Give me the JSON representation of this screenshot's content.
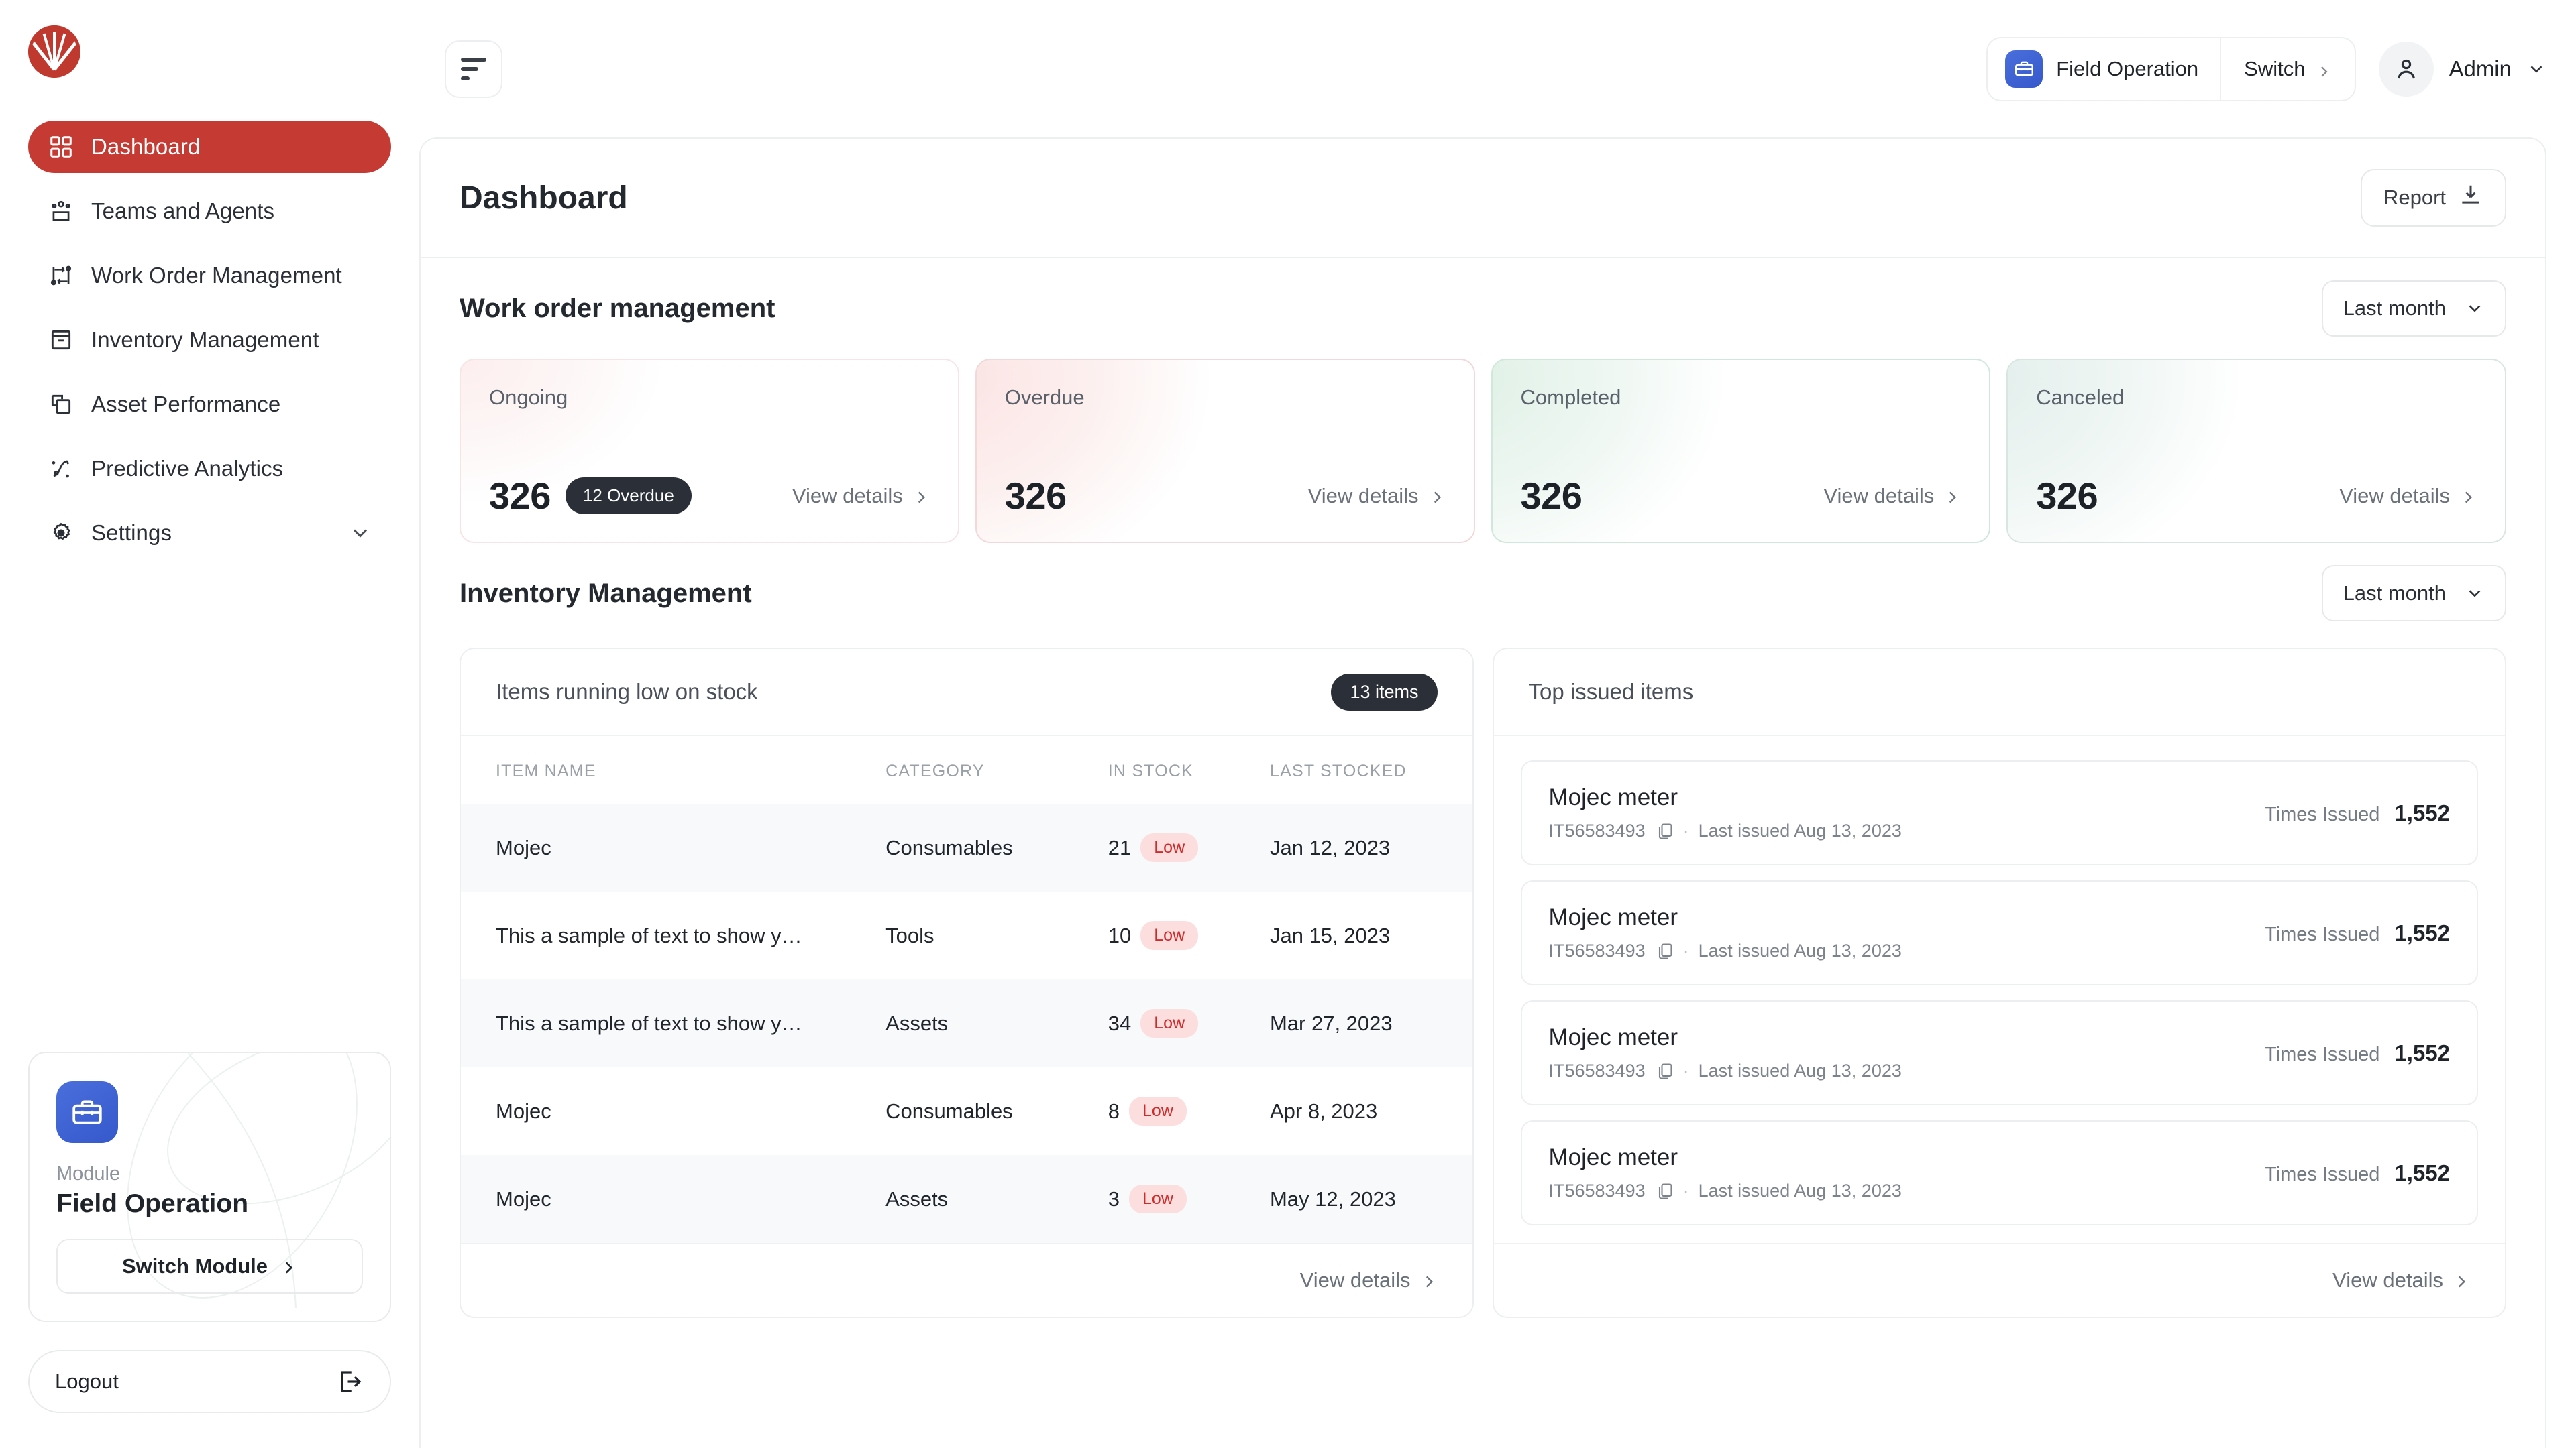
{
  "brand": {
    "logo_name": "company-logo",
    "accent": "#c53a33"
  },
  "sidebar": {
    "items": [
      {
        "label": "Dashboard",
        "icon": "grid-icon",
        "active": true
      },
      {
        "label": "Teams and Agents",
        "icon": "users-icon",
        "active": false
      },
      {
        "label": "Work Order Management",
        "icon": "workflow-icon",
        "active": false
      },
      {
        "label": "Inventory Management",
        "icon": "inventory-box-icon",
        "active": false
      },
      {
        "label": "Asset Performance",
        "icon": "copy-layers-icon",
        "active": false
      },
      {
        "label": "Predictive Analytics",
        "icon": "strategy-icon",
        "active": false
      },
      {
        "label": "Settings",
        "icon": "gear-icon",
        "active": false,
        "expandable": true
      }
    ],
    "module_card": {
      "icon": "toolbox-icon",
      "label": "Module",
      "title": "Field Operation",
      "switch_label": "Switch Module"
    },
    "logout_label": "Logout",
    "logout_icon": "logout-icon"
  },
  "topbar": {
    "collapse_icon": "collapse-sidebar-icon",
    "module_pill": {
      "icon": "toolbox-icon",
      "name": "Field Operation",
      "switch_label": "Switch"
    },
    "user": {
      "name": "Admin",
      "avatar_icon": "user-avatar-icon",
      "chevron": "chevron-down-icon"
    }
  },
  "page": {
    "title": "Dashboard",
    "report_button": "Report",
    "report_icon": "download-icon"
  },
  "work_order_section": {
    "title": "Work order management",
    "period": "Last month",
    "cards": [
      {
        "label": "Ongoing",
        "value": "326",
        "badge": "12 Overdue",
        "link": "View details",
        "tint": "tint-rose"
      },
      {
        "label": "Overdue",
        "value": "326",
        "badge": "",
        "link": "View details",
        "tint": "tint-rose2"
      },
      {
        "label": "Completed",
        "value": "326",
        "badge": "",
        "link": "View details",
        "tint": "tint-green"
      },
      {
        "label": "Canceled",
        "value": "326",
        "badge": "",
        "link": "View details",
        "tint": "tint-teal"
      }
    ]
  },
  "inventory_section": {
    "title": "Inventory Management",
    "period": "Last month",
    "low_stock": {
      "title": "Items running low on stock",
      "count_badge": "13 items",
      "columns": [
        "ITEM NAME",
        "CATEGORY",
        "IN STOCK",
        "LAST STOCKED"
      ],
      "rows": [
        {
          "name": "Mojec",
          "category": "Consumables",
          "stock": "21",
          "status": "Low",
          "last_stocked": "Jan 12, 2023"
        },
        {
          "name": "This a sample of text to show y…",
          "category": "Tools",
          "stock": "10",
          "status": "Low",
          "last_stocked": "Jan 15, 2023"
        },
        {
          "name": "This a sample of text to show y…",
          "category": "Assets",
          "stock": "34",
          "status": "Low",
          "last_stocked": "Mar 27, 2023"
        },
        {
          "name": "Mojec",
          "category": "Consumables",
          "stock": "8",
          "status": "Low",
          "last_stocked": "Apr 8, 2023"
        },
        {
          "name": "Mojec",
          "category": "Assets",
          "stock": "3",
          "status": "Low",
          "last_stocked": "May 12, 2023"
        }
      ],
      "footer_link": "View details"
    },
    "top_issued": {
      "title": "Top issued items",
      "items": [
        {
          "name": "Mojec meter",
          "code": "IT56583493",
          "last_issued": "Last issued Aug 13, 2023",
          "times_issued_label": "Times Issued",
          "times_issued": "1,552"
        },
        {
          "name": "Mojec meter",
          "code": "IT56583493",
          "last_issued": "Last issued Aug 13, 2023",
          "times_issued_label": "Times Issued",
          "times_issued": "1,552"
        },
        {
          "name": "Mojec meter",
          "code": "IT56583493",
          "last_issued": "Last issued Aug 13, 2023",
          "times_issued_label": "Times Issued",
          "times_issued": "1,552"
        },
        {
          "name": "Mojec meter",
          "code": "IT56583493",
          "last_issued": "Last issued Aug 13, 2023",
          "times_issued_label": "Times Issued",
          "times_issued": "1,552"
        }
      ],
      "footer_link": "View details"
    }
  }
}
